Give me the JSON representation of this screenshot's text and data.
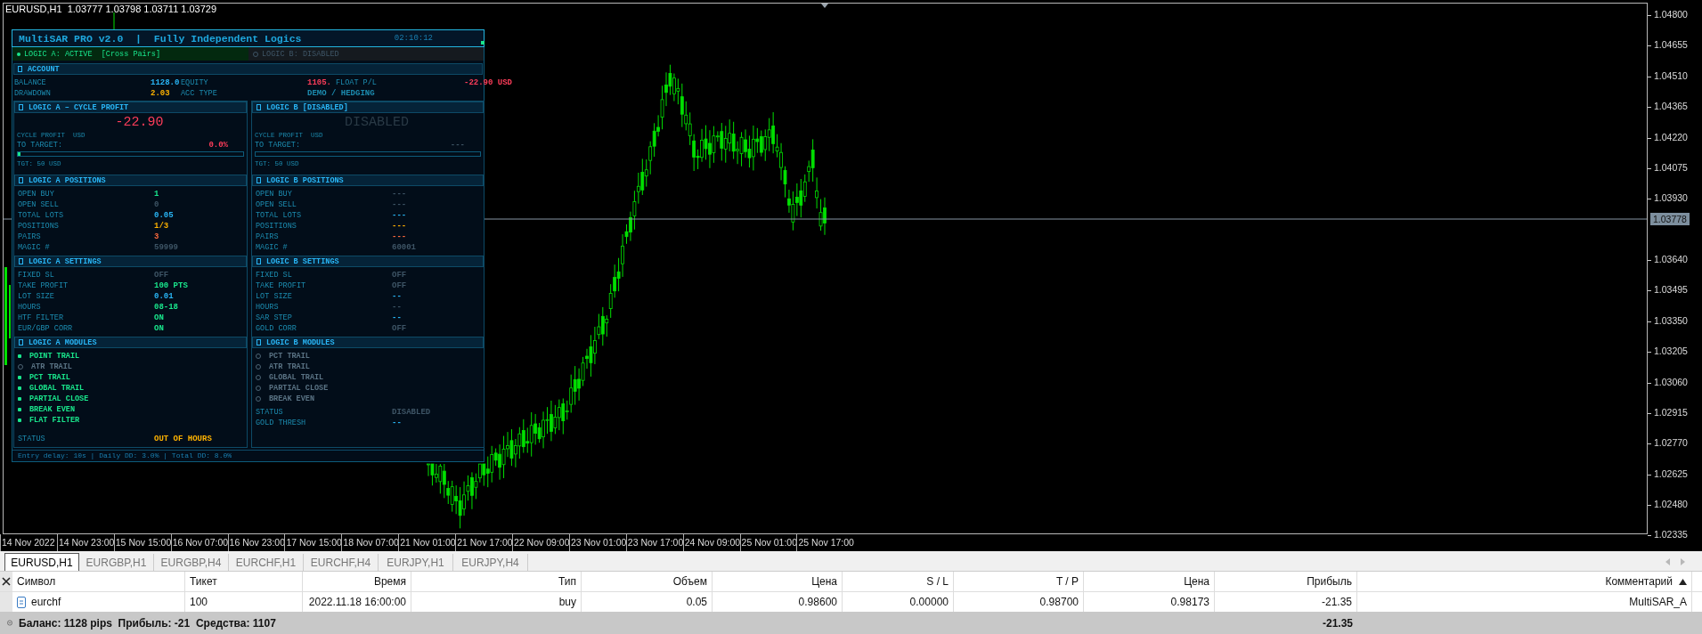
{
  "chart": {
    "symbol_line": "EURUSD,H1  1.03777 1.03798 1.03711 1.03729",
    "price_labels": [
      "1.04800",
      "1.04655",
      "1.04510",
      "1.04365",
      "1.04220",
      "1.04075",
      "1.03930",
      "1.03640",
      "1.03495",
      "1.03350",
      "1.03205",
      "1.03060",
      "1.02915",
      "1.02770",
      "1.02625",
      "1.02480",
      "1.02335"
    ],
    "current_price": "1.03778",
    "time_labels": [
      "14 Nov 2022",
      "14 Nov 23:00",
      "15 Nov 15:00",
      "16 Nov 07:00",
      "16 Nov 23:00",
      "17 Nov 15:00",
      "18 Nov 07:00",
      "21 Nov 01:00",
      "21 Nov 17:00",
      "22 Nov 09:00",
      "23 Nov 01:00",
      "23 Nov 17:00",
      "24 Nov 09:00",
      "25 Nov 01:00",
      "25 Nov 17:00"
    ]
  },
  "panel": {
    "title": "MultiSAR PRO v2.0  |  Fully Independent Logics",
    "clock": "02:10:12",
    "logic_bar": [
      {
        "label": "LOGIC A: ACTIVE  [Cross Pairs]",
        "active": true
      },
      {
        "label": "LOGIC B: DISABLED",
        "active": false
      }
    ],
    "account": {
      "title": "ACCOUNT",
      "rows": [
        [
          {
            "label": "BALANCE",
            "value": "1128.0",
            "color": "#29b6f6"
          },
          {
            "label": "EQUITY",
            "value": "1105.",
            "color": "#ff3d5a"
          },
          {
            "label": "FLOAT P/L",
            "value": "-22.90 USD",
            "color": "#ff3d5a"
          }
        ],
        [
          {
            "label": "DRAWDOWN",
            "value": "2.03",
            "color": "#ffb300"
          },
          {
            "label": "ACC TYPE",
            "value": "DEMO / HEDGING",
            "color": "#1c8cb0"
          }
        ]
      ]
    },
    "columns": [
      {
        "cycle": {
          "title": "LOGIC A – CYCLE PROFIT",
          "amount": "-22.90",
          "color": "#ff3d5a",
          "caption": "CYCLE PROFIT  USD",
          "target": {
            "label": "TO TARGET:",
            "value": "0.0%",
            "color": "#ff3d5a"
          },
          "level": 0.01,
          "tgt": "TGT: 50 USD"
        },
        "positions": {
          "title": "LOGIC A POSITIONS",
          "rows": [
            {
              "label": "OPEN BUY",
              "value": "1",
              "color": "#19e68c"
            },
            {
              "label": "OPEN SELL",
              "value": "0",
              "color": "#3e5566"
            },
            {
              "label": "TOTAL LOTS",
              "value": "0.05",
              "color": "#29b6f6"
            },
            {
              "label": "POSITIONS",
              "value": "1/3",
              "color": "#ffb300"
            },
            {
              "label": "PAIRS",
              "value": "3",
              "color": "#ff6a3d"
            },
            {
              "label": "MAGIC #",
              "value": "59999",
              "color": "#3e5566"
            }
          ]
        },
        "settings": {
          "title": "LOGIC A SETTINGS",
          "rows": [
            {
              "label": "FIXED SL",
              "value": "OFF",
              "color": "#3e5566"
            },
            {
              "label": "TAKE PROFIT",
              "value": "100 PTS",
              "color": "#19e68c"
            },
            {
              "label": "LOT SIZE",
              "value": "0.01",
              "color": "#29b6f6"
            },
            {
              "label": "HOURS",
              "value": "08-18",
              "color": "#19e68c"
            },
            {
              "label": "HTF FILTER",
              "value": "ON",
              "color": "#19e68c"
            },
            {
              "label": "EUR/GBP CORR",
              "value": "ON",
              "color": "#19e68c"
            }
          ]
        },
        "modules": {
          "title": "LOGIC A MODULES",
          "items": [
            {
              "label": "POINT TRAIL",
              "on": true
            },
            {
              "label": "ATR TRAIL",
              "on": false
            },
            {
              "label": "PCT TRAIL",
              "on": true
            },
            {
              "label": "GLOBAL TRAIL",
              "on": true
            },
            {
              "label": "PARTIAL CLOSE",
              "on": true
            },
            {
              "label": "BREAK EVEN",
              "on": true
            },
            {
              "label": "FLAT FILTER",
              "on": true
            }
          ],
          "rows": [
            {
              "label": "STATUS",
              "value": "OUT OF HOURS",
              "color": "#ffb300"
            }
          ]
        }
      },
      {
        "cycle": {
          "title": "LOGIC B [DISABLED]",
          "amount": "DISABLED",
          "color": "#2a3a46",
          "caption": "CYCLE PROFIT  USD",
          "target": {
            "label": "TO TARGET:",
            "value": "---",
            "color": "#3e5566"
          },
          "tgt": "TGT: 50 USD"
        },
        "positions": {
          "title": "LOGIC B POSITIONS",
          "rows": [
            {
              "label": "OPEN BUY",
              "value": "---",
              "color": "#3e5566"
            },
            {
              "label": "OPEN SELL",
              "value": "---",
              "color": "#3e5566"
            },
            {
              "label": "TOTAL LOTS",
              "value": "---",
              "color": "#29b6f6"
            },
            {
              "label": "POSITIONS",
              "value": "---",
              "color": "#ffb300"
            },
            {
              "label": "PAIRS",
              "value": "---",
              "color": "#ff6a3d"
            },
            {
              "label": "MAGIC #",
              "value": "60001",
              "color": "#3e5566"
            }
          ]
        },
        "settings": {
          "title": "LOGIC B SETTINGS",
          "rows": [
            {
              "label": "FIXED SL",
              "value": "OFF",
              "color": "#3e5566"
            },
            {
              "label": "TAKE PROFIT",
              "value": "OFF",
              "color": "#3e5566"
            },
            {
              "label": "LOT SIZE",
              "value": "--",
              "color": "#29b6f6"
            },
            {
              "label": "HOURS",
              "value": "--",
              "color": "#3e5566"
            },
            {
              "label": "SAR STEP",
              "value": "--",
              "color": "#29b6f6"
            },
            {
              "label": "GOLD CORR",
              "value": "OFF",
              "color": "#3e5566"
            }
          ]
        },
        "modules": {
          "title": "LOGIC B MODULES",
          "items": [
            {
              "label": "PCT TRAIL",
              "on": false
            },
            {
              "label": "ATR TRAIL",
              "on": false
            },
            {
              "label": "GLOBAL TRAIL",
              "on": false
            },
            {
              "label": "PARTIAL CLOSE",
              "on": false
            },
            {
              "label": "BREAK EVEN",
              "on": false
            }
          ],
          "rows": [
            {
              "label": "STATUS",
              "value": "DISABLED",
              "color": "#3e5566"
            },
            {
              "label": "GOLD THRESH",
              "value": "--",
              "color": "#29b6f6"
            }
          ]
        }
      }
    ],
    "footer": "Entry delay: 10s | Daily DD: 3.0% | Total DD: 8.0%"
  },
  "terminal": {
    "tabs": [
      {
        "label": "EURUSD,H1",
        "selected": true
      },
      {
        "label": "EURGBP,H1",
        "selected": false
      },
      {
        "label": "EURGBP,H4",
        "selected": false
      },
      {
        "label": "EURCHF,H1",
        "selected": false
      },
      {
        "label": "EURCHF,H4",
        "selected": false
      },
      {
        "label": "EURJPY,H1",
        "selected": false
      },
      {
        "label": "EURJPY,H4",
        "selected": false
      }
    ],
    "columns": [
      "Символ",
      "Тикет",
      "Время",
      "Тип",
      "Объем",
      "Цена",
      "S / L",
      "T / P",
      "Цена",
      "Прибыль",
      "Комментарий"
    ],
    "rows": [
      {
        "cells": [
          "eurchf",
          "100",
          "2022.11.18 16:00:00",
          "buy",
          "0.05",
          "0.98600",
          "0.00000",
          "0.98700",
          "0.98173",
          "-21.35",
          "MultiSAR_A"
        ]
      }
    ],
    "summary": {
      "text": "Баланс: 1128 pips  Прибыль: -21  Средства: 1107",
      "profit": "-21.35"
    }
  }
}
